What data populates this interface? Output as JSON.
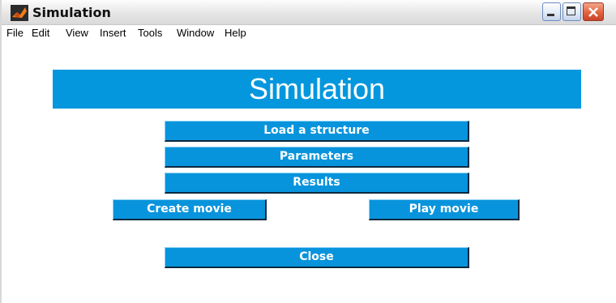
{
  "window": {
    "title": "Simulation"
  },
  "menu": {
    "items": [
      "File",
      "Edit",
      "View",
      "Insert",
      "Tools",
      "Window",
      "Help"
    ]
  },
  "banner": {
    "text": "Simulation"
  },
  "buttons": {
    "load": "Load a structure",
    "parameters": "Parameters",
    "results": "Results",
    "create_movie": "Create movie",
    "play_movie": "Play movie",
    "close": "Close"
  },
  "icons": {
    "app": "matlab-icon",
    "minimize": "minimize-icon",
    "maximize": "maximize-icon",
    "close": "close-icon"
  },
  "colors": {
    "accent": "#0497de",
    "button": "#0894dc",
    "close_button": "#e2633f"
  }
}
